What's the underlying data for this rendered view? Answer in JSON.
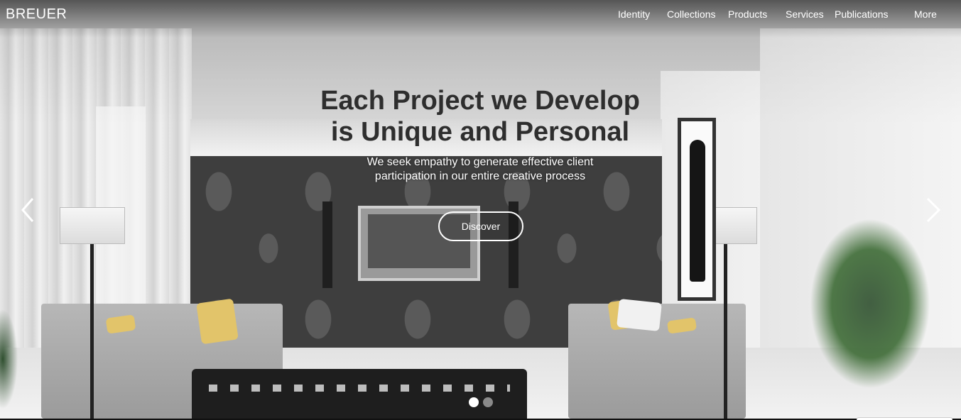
{
  "brand": "BREUER",
  "nav": {
    "items": [
      "Identity",
      "Collections",
      "Products",
      "Services",
      "Publications",
      "More"
    ]
  },
  "hero": {
    "headline_line1": "Each Project we Develop",
    "headline_line2": "is Unique and Personal",
    "sub_line1": "We seek empathy to generate effective client",
    "sub_line2": "participation in our entire creative process",
    "cta_label": "Discover",
    "slide_count": 2,
    "active_slide": 1
  },
  "icons": {
    "prev": "chevron-left-icon",
    "next": "chevron-right-icon"
  },
  "colors": {
    "headline": "#2e2e2e",
    "nav_text": "#ffffff",
    "dot_active": "#ffffff",
    "dot_inactive": "#8a8a8a"
  }
}
